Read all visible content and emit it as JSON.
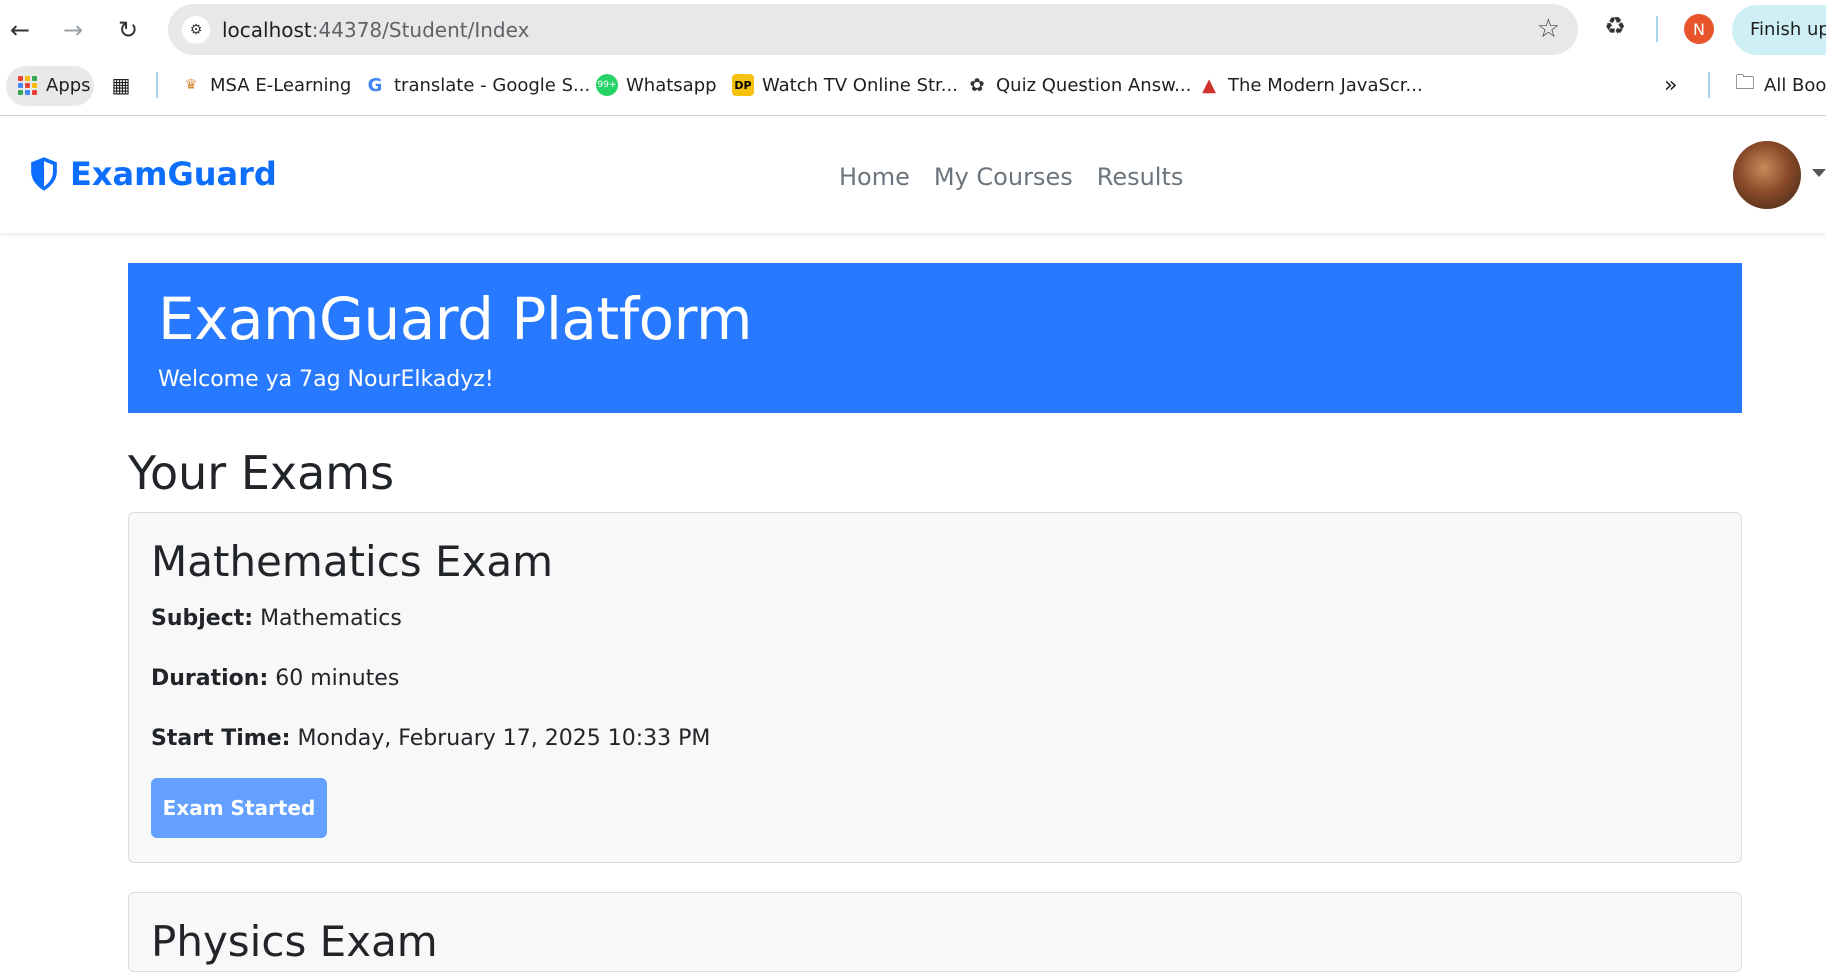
{
  "browser": {
    "url_host": "localhost",
    "url_path": ":44378/Student/Index",
    "profile_initial": "N",
    "finish_update_label": "Finish update",
    "bookmarks": [
      {
        "label": "Apps"
      },
      {
        "label": "MSA E-Learning"
      },
      {
        "label": "translate - Google S..."
      },
      {
        "label": "Whatsapp"
      },
      {
        "label": "Watch TV Online Str..."
      },
      {
        "label": "Quiz Question Answ..."
      },
      {
        "label": "The Modern JavaScr..."
      },
      {
        "label": "All Bookmarks"
      }
    ],
    "overflow_label": "»"
  },
  "site": {
    "brand": "ExamGuard",
    "brand_color": "#0d6efd",
    "nav": [
      "Home",
      "My Courses",
      "Results"
    ]
  },
  "hero": {
    "title": "ExamGuard Platform",
    "welcome": "Welcome ya 7ag NourElkadyz!",
    "bg_color": "#2779ff"
  },
  "section_title": "Your Exams",
  "exams": [
    {
      "title": "Mathematics Exam",
      "subject_label": "Subject:",
      "subject": "Mathematics",
      "duration_label": "Duration:",
      "duration": "60 minutes",
      "start_label": "Start Time:",
      "start_time": "Monday, February 17, 2025 10:33 PM",
      "button": "Exam Started"
    },
    {
      "title": "Physics Exam"
    }
  ]
}
